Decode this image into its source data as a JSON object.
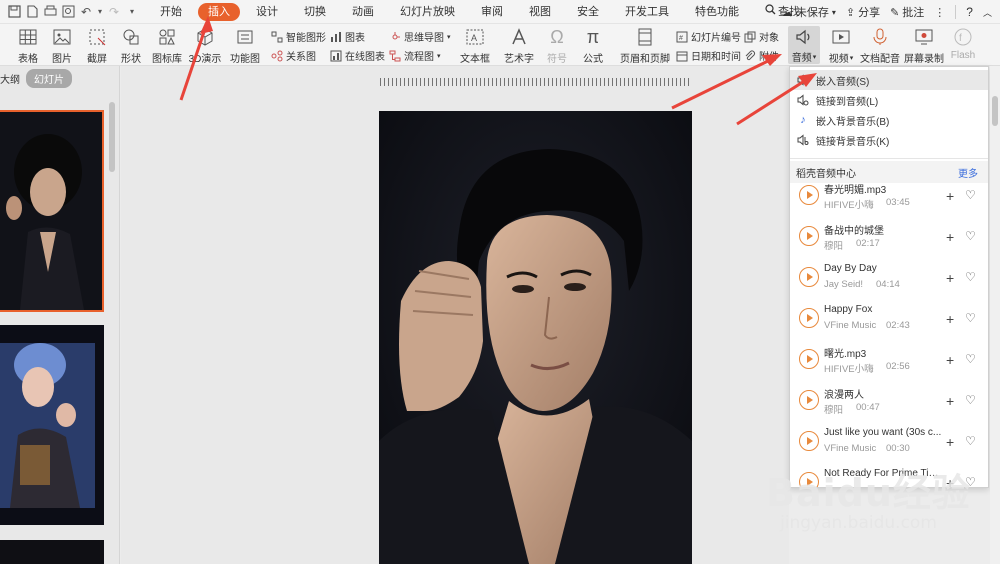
{
  "menubar": {
    "tabs": [
      "开始",
      "插入",
      "设计",
      "切换",
      "动画",
      "幻灯片放映",
      "审阅",
      "视图",
      "安全",
      "开发工具",
      "特色功能",
      "查找"
    ],
    "active_tab": "插入",
    "unsaved": "未保存",
    "share": "分享",
    "comment": "批注",
    "help": "?"
  },
  "ribbon": {
    "table": "表格",
    "image": "图片",
    "screenshot": "截屏",
    "shape": "形状",
    "icon_lib": "图标库",
    "demo3d": "3D演示",
    "func_chart": "功能图",
    "smart_shape": "智能图形",
    "relation": "关系图",
    "chart": "图表",
    "online_chart": "在线图表",
    "mindmap": "思维导图",
    "flowchart": "流程图",
    "textbox": "文本框",
    "wordart": "艺术字",
    "symbol": "符号",
    "formula": "公式",
    "header_footer": "页眉和页脚",
    "slide_number": "幻灯片编号",
    "datetime": "日期和时间",
    "object": "对象",
    "attachment": "附件",
    "audio": "音频",
    "video": "视频",
    "narration": "文档配音",
    "screen_record": "屏幕录制",
    "flash": "Flash"
  },
  "left_panel": {
    "outline": "大纲",
    "slides": "幻灯片"
  },
  "dropdown": {
    "items": [
      {
        "label": "嵌入音频(S)",
        "icon": "speaker-icon"
      },
      {
        "label": "链接到音频(L)",
        "icon": "speaker-link-icon"
      },
      {
        "label": "嵌入背景音乐(B)",
        "icon": "music-note-icon"
      },
      {
        "label": "链接背景音乐(K)",
        "icon": "music-link-icon"
      }
    ],
    "section_title": "稻壳音频中心",
    "more": "更多",
    "songs": [
      {
        "title": "春光明媚.mp3",
        "artist": "HIFIVE小嗨",
        "duration": "03:45"
      },
      {
        "title": "备战中的城堡",
        "artist": "穆阳",
        "duration": "02:17"
      },
      {
        "title": "Day By Day",
        "artist": "Jay Seid!",
        "duration": "04:14"
      },
      {
        "title": "Happy Fox",
        "artist": "VFine Music",
        "duration": "02:43"
      },
      {
        "title": "曙光.mp3",
        "artist": "HIFIVE小嗨",
        "duration": "02:56"
      },
      {
        "title": "浪漫两人",
        "artist": "穆阳",
        "duration": "00:47"
      },
      {
        "title": "Just like you want (30s c...",
        "artist": "VFine Music",
        "duration": "00:30"
      },
      {
        "title": "Not Ready For Prime Tim...",
        "artist": "",
        "duration": ""
      }
    ]
  },
  "watermark": {
    "brand": "Baidu经验",
    "url": "jingyan.baidu.com"
  },
  "colors": {
    "accent": "#e8612c",
    "arrow": "#e8443a",
    "link": "#3b6ddc"
  }
}
